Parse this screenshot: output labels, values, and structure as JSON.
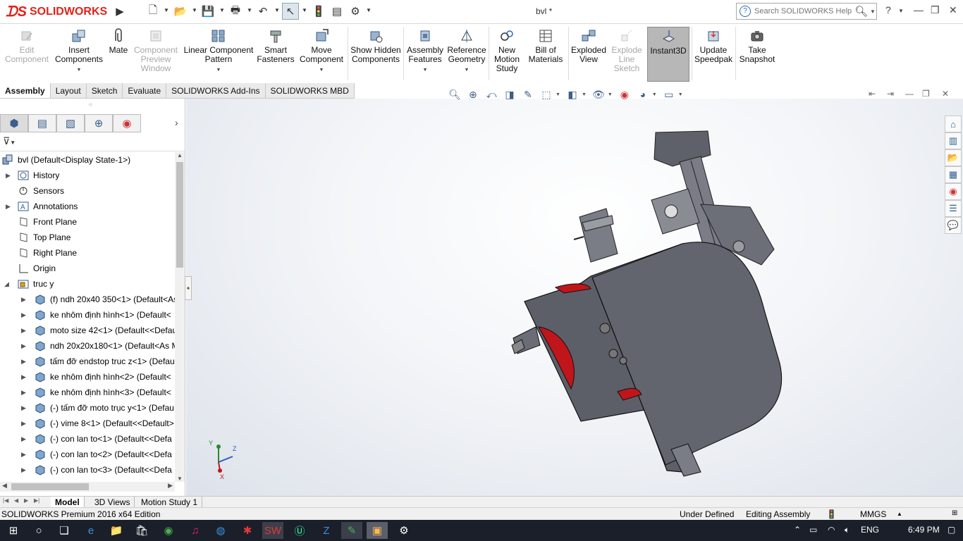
{
  "app": {
    "brand": "SOLIDWORKS",
    "document_title": "bvl *",
    "search_placeholder": "Search SOLIDWORKS Help",
    "brand_color": "#e2231a"
  },
  "ribbon": {
    "buttons": [
      {
        "label": "Edit Component",
        "icon": "edit-component-icon",
        "enabled": false
      },
      {
        "label": "Insert Components",
        "icon": "insert-components-icon",
        "enabled": true
      },
      {
        "label": "Mate",
        "icon": "paperclip-icon",
        "enabled": true
      },
      {
        "label": "Component Preview Window",
        "icon": "preview-window-icon",
        "enabled": false
      },
      {
        "label": "Linear Component Pattern",
        "icon": "pattern-icon",
        "enabled": true
      },
      {
        "label": "Smart Fasteners",
        "icon": "fastener-icon",
        "enabled": true
      },
      {
        "label": "Move Component",
        "icon": "move-component-icon",
        "enabled": true
      },
      {
        "label": "Show Hidden Components",
        "icon": "show-hidden-icon",
        "enabled": true
      },
      {
        "label": "Assembly Features",
        "icon": "assembly-features-icon",
        "enabled": true
      },
      {
        "label": "Reference Geometry",
        "icon": "reference-geometry-icon",
        "enabled": true
      },
      {
        "label": "New Motion Study",
        "icon": "motion-study-icon",
        "enabled": true
      },
      {
        "label": "Bill of Materials",
        "icon": "bom-icon",
        "enabled": true
      },
      {
        "label": "Exploded View",
        "icon": "exploded-view-icon",
        "enabled": true
      },
      {
        "label": "Explode Line Sketch",
        "icon": "explode-line-icon",
        "enabled": false
      },
      {
        "label": "Instant3D",
        "icon": "instant3d-icon",
        "enabled": true
      },
      {
        "label": "Update Speedpak",
        "icon": "speedpak-icon",
        "enabled": true
      },
      {
        "label": "Take Snapshot",
        "icon": "camera-icon",
        "enabled": true
      }
    ]
  },
  "cm_tabs": [
    "Assembly",
    "Layout",
    "Sketch",
    "Evaluate",
    "SOLIDWORKS Add-Ins",
    "SOLIDWORKS MBD"
  ],
  "tree": {
    "root": "bvl  (Default<Display State-1>)",
    "items": [
      {
        "label": "History",
        "icon": "history-icon"
      },
      {
        "label": "Sensors",
        "icon": "sensor-icon"
      },
      {
        "label": "Annotations",
        "icon": "annotation-icon"
      },
      {
        "label": "Front Plane",
        "icon": "plane-icon"
      },
      {
        "label": "Top Plane",
        "icon": "plane-icon"
      },
      {
        "label": "Right Plane",
        "icon": "plane-icon"
      },
      {
        "label": "Origin",
        "icon": "origin-icon"
      },
      {
        "label": "truc y",
        "icon": "subassembly-icon"
      }
    ],
    "children": [
      "(f) ndh 20x40 350<1> (Default<As",
      "ke nhôm định hình<1> (Default<",
      "moto size 42<1> (Default<<Defau",
      "ndh 20x20x180<1> (Default<As M",
      "tấm đỡ endstop truc z<1> (Defau",
      "ke nhôm định hình<2> (Default<",
      "ke nhôm định hình<3> (Default<",
      "(-) tấm đỡ moto trục y<1> (Defau",
      "(-) vime 8<1> (Default<<Default>",
      "(-) con lan to<1> (Default<<Defa",
      "(-) con lan to<2> (Default<<Defa",
      "(-) con lan to<3> (Default<<Defa"
    ]
  },
  "bottom_tabs": [
    "Model",
    "3D Views",
    "Motion Study 1"
  ],
  "status": {
    "edition": "SOLIDWORKS Premium 2016 x64 Edition",
    "state": "Under Defined",
    "mode": "Editing Assembly",
    "units": "MMGS"
  },
  "triad": {
    "y": "Y",
    "z": "Z",
    "x": "X"
  },
  "taskbar": {
    "lang": "ENG",
    "time": "6:49 PM"
  },
  "colors": {
    "model_gray": "#5c5e68",
    "model_red": "#c0151b",
    "accent_blue": "#2a6cb3"
  }
}
